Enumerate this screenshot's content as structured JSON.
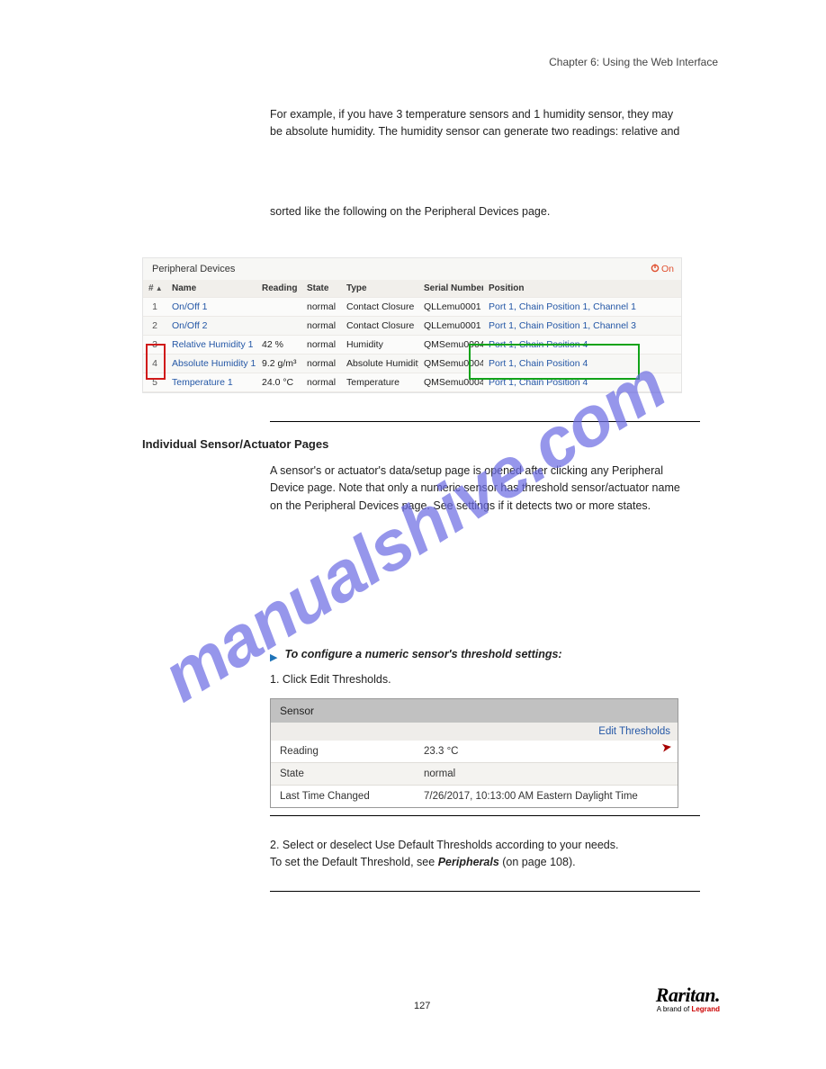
{
  "chapter_heading": "Chapter 6: Using the Web Interface",
  "intro_para_html": "For example, if you have 3 temperature sensors and 1 humidity sensor, they may be absolute humidity. The humidity sensor can generate two readings: relative and",
  "intro_para2": "sorted like the following on the Peripheral Devices page.",
  "peripheral": {
    "title": "Peripheral Devices",
    "on_label": "On",
    "headers": {
      "num": "#",
      "name": "Name",
      "reading": "Reading",
      "state": "State",
      "type": "Type",
      "serial": "Serial Number",
      "position": "Position"
    },
    "rows": [
      {
        "num": "1",
        "name": "On/Off 1",
        "reading": "",
        "state": "normal",
        "type": "Contact Closure",
        "serial": "QLLemu0001",
        "position": "Port 1, Chain Position 1, Channel 1"
      },
      {
        "num": "2",
        "name": "On/Off 2",
        "reading": "",
        "state": "normal",
        "type": "Contact Closure",
        "serial": "QLLemu0001",
        "position": "Port 1, Chain Position 1, Channel 3"
      },
      {
        "num": "3",
        "name": "Relative Humidity 1",
        "reading": "42 %",
        "state": "normal",
        "type": "Humidity",
        "serial": "QMSemu0004",
        "position": "Port 1, Chain Position 4"
      },
      {
        "num": "4",
        "name": "Absolute Humidity 1",
        "reading": "9.2 g/m³",
        "state": "normal",
        "type": "Absolute Humidity",
        "serial": "QMSemu0004",
        "position": "Port 1, Chain Position 4"
      },
      {
        "num": "5",
        "name": "Temperature 1",
        "reading": "24.0 °C",
        "state": "normal",
        "type": "Temperature",
        "serial": "QMSemu0004",
        "position": "Port 1, Chain Position 4"
      }
    ]
  },
  "section_title": "Individual Sensor/Actuator Pages",
  "para3": "A sensor's or actuator's data/setup page is opened after clicking any Peripheral Device page. Note that only a numeric sensor has threshold sensor/actuator name on the Peripheral Devices page. See settings if it detects two or more states.",
  "bullet_label": "To configure a numeric sensor's threshold settings:",
  "step1": "1. Click Edit Thresholds.",
  "sensor": {
    "title": "Sensor",
    "edit_link": "Edit Thresholds",
    "rows": [
      {
        "label": "Reading",
        "value": "23.3 °C"
      },
      {
        "label": "State",
        "value": "normal"
      },
      {
        "label": "Last Time Changed",
        "value": "7/26/2017, 10:13:00 AM Eastern Daylight Time"
      }
    ]
  },
  "step2_lead": "2. Select or deselect Use Default Thresholds according to your needs.",
  "step2_note_prefix": "To set the Default Threshold, see ",
  "step2_xref": "Peripherals",
  "step2_note_suffix": "(on page 108).",
  "footer": {
    "brand": "Raritan.",
    "sub_prefix": "A brand of ",
    "sub_brand": "Legrand"
  },
  "page_number": "127",
  "watermark": "manualshive.com"
}
